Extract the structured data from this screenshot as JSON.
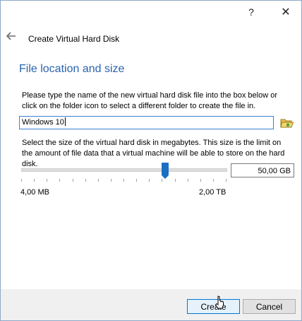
{
  "titlebar": {
    "help_glyph": "?",
    "close_glyph": "✕"
  },
  "header": {
    "back_icon": "back-arrow-icon",
    "title": "Create Virtual Hard Disk"
  },
  "page": {
    "heading": "File location and size",
    "file_description": "Please type the name of the new virtual hard disk file into the box below or click on the folder icon to select a different folder to create the file in.",
    "file_name": "Windows 10",
    "folder_icon": "folder-open-icon",
    "size_description": "Select the size of the virtual hard disk in megabytes. This size is the limit on the amount of file data that a virtual machine will be able to store on the hard disk.",
    "size_value": "50,00 GB",
    "slider_fraction": 0.7,
    "range_min": "4,00 MB",
    "range_max": "2,00 TB"
  },
  "footer": {
    "create_label": "Create",
    "cancel_label": "Cancel"
  },
  "colors": {
    "heading": "#2a63b1",
    "accent": "#1a6fc4",
    "focus_border": "#3c7fd1"
  }
}
